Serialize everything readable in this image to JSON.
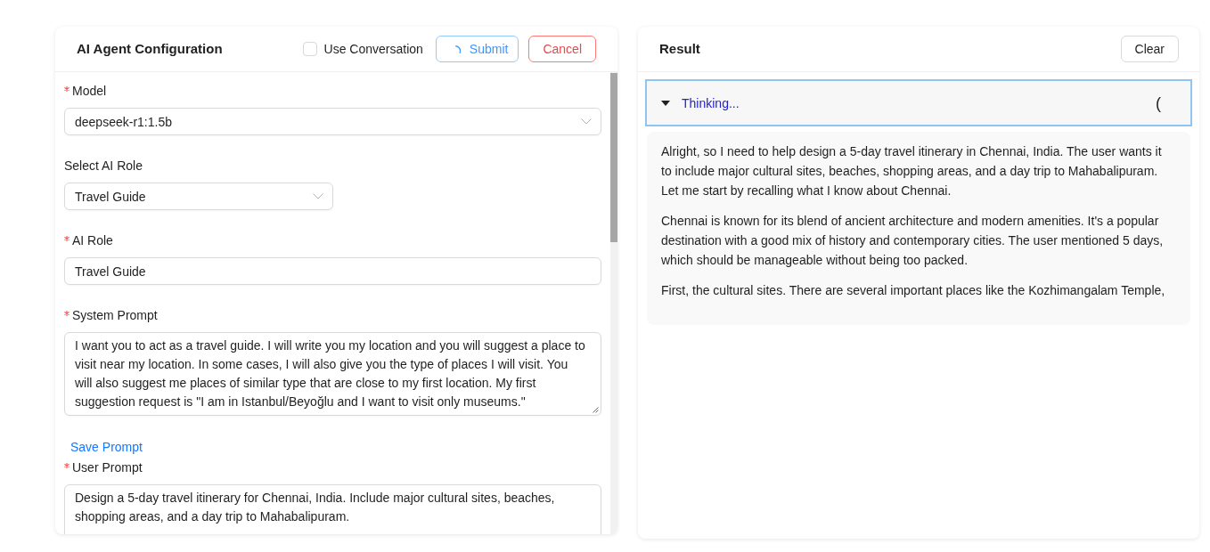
{
  "config_panel": {
    "title": "AI Agent Configuration",
    "use_conversation": {
      "label": "Use Conversation",
      "checked": false
    },
    "buttons": [
      {
        "label": "Submit",
        "kind": "primary",
        "loading": true
      },
      {
        "label": "Cancel",
        "kind": "danger"
      }
    ]
  },
  "form": {
    "fields": [
      {
        "kind": "select",
        "label": "Model",
        "required": true,
        "value": "deepseek-r1:1.5b"
      },
      {
        "kind": "short_select",
        "label": "Select AI Role",
        "required": false,
        "value": "Travel Guide"
      },
      {
        "kind": "input",
        "label": "AI Role",
        "required": true,
        "value": "Travel Guide"
      },
      {
        "kind": "textarea",
        "label": "System Prompt",
        "required": true,
        "value": "I want you to act as a travel guide. I will write you my location and you will suggest a place to visit near my location. In some cases, I will also give you the type of places I will visit. You will also suggest me places of similar type that are close to my first location. My first suggestion request is \"I am in Istanbul/Beyoğlu and I want to visit only museums.\"",
        "resize_handle": true
      },
      {
        "kind": "link",
        "label": "Save Prompt"
      },
      {
        "kind": "textarea",
        "label": "User Prompt",
        "required": true,
        "value": "Design a 5-day travel itinerary for Chennai, India. Include major cultural sites, beaches, shopping areas, and a day trip to Mahabalipuram."
      }
    ]
  },
  "result_panel": {
    "title": "Result",
    "buttons": [
      {
        "label": "Clear",
        "kind": "default"
      }
    ],
    "thinking": {
      "label": "Thinking...",
      "expanded": true,
      "indicator": "("
    },
    "paragraphs": [
      "Alright, so I need to help design a 5-day travel itinerary in Chennai, India. The user wants it to include major cultural sites, beaches, shopping areas, and a day trip to Mahabalipuram. Let me start by recalling what I know about Chennai.",
      "Chennai is known for its blend of ancient architecture and modern amenities. It's a popular destination with a good mix of history and contemporary cities. The user mentioned 5 days, which should be manageable without being too packed.",
      "First, the cultural sites. There are several important places like the Kozhimangalam Temple,"
    ]
  }
}
